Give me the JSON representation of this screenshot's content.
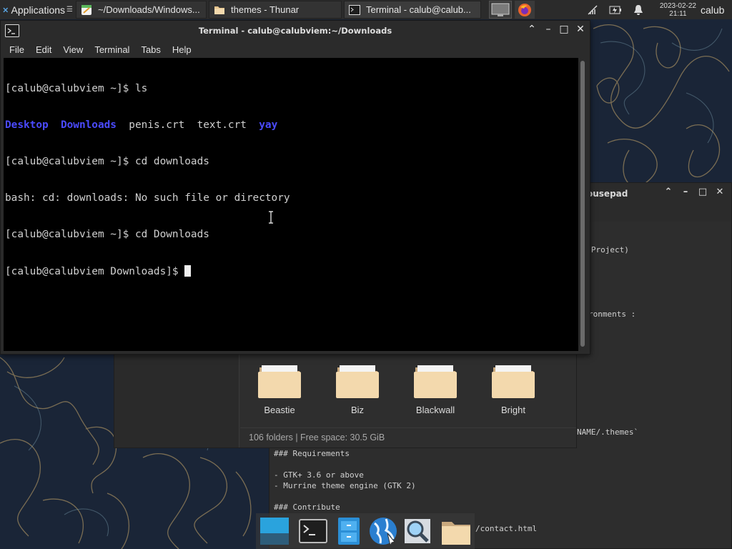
{
  "top_panel": {
    "applications_label": "Applications",
    "tasks": [
      {
        "label": "~/Downloads/Windows..."
      },
      {
        "label": "themes - Thunar"
      },
      {
        "label": "Terminal - calub@calub..."
      }
    ],
    "clock_date": "2023-02-22",
    "clock_time": "21:11",
    "user": "calub"
  },
  "terminal": {
    "title": "Terminal - calub@calubviem:~/Downloads",
    "menu": [
      "File",
      "Edit",
      "View",
      "Terminal",
      "Tabs",
      "Help"
    ],
    "lines": {
      "l1": "[calub@calubviem ~]$ ls",
      "l2_dir1": "Desktop",
      "l2_dir2": "Downloads",
      "l2_files": "penis.crt  text.crt",
      "l2_dir3": "yay",
      "l3": "[calub@calubviem ~]$ cd downloads",
      "l4": "bash: cd: downloads: No such file or directory",
      "l5": "[calub@calubviem ~]$ cd Downloads",
      "l6": "[calub@calubviem Downloads]$ "
    }
  },
  "thunar": {
    "folders": [
      "Beastie",
      "Biz",
      "Blackwall",
      "Bright"
    ],
    "status": "106 folders  |  Free space: 30.5 GiB"
  },
  "mousepad": {
    "title_fragment": "ousepad",
    "fragments": {
      "f1": "ng-Project)",
      "f2": "ronments :",
      "f3": "NAME/.themes`"
    },
    "text_lines": [
      "### Requirements",
      "",
      "- GTK+ 3.6 or above",
      "- Murrine theme engine (GTK 2)",
      "",
      "### Contribute"
    ],
    "last_fragment": "/contact.html"
  },
  "colors": {
    "panel_bg": "#2b2b2b",
    "terminal_bg": "#000000",
    "directory_blue": "#4b4bff",
    "wallpaper": "#1a2537"
  }
}
